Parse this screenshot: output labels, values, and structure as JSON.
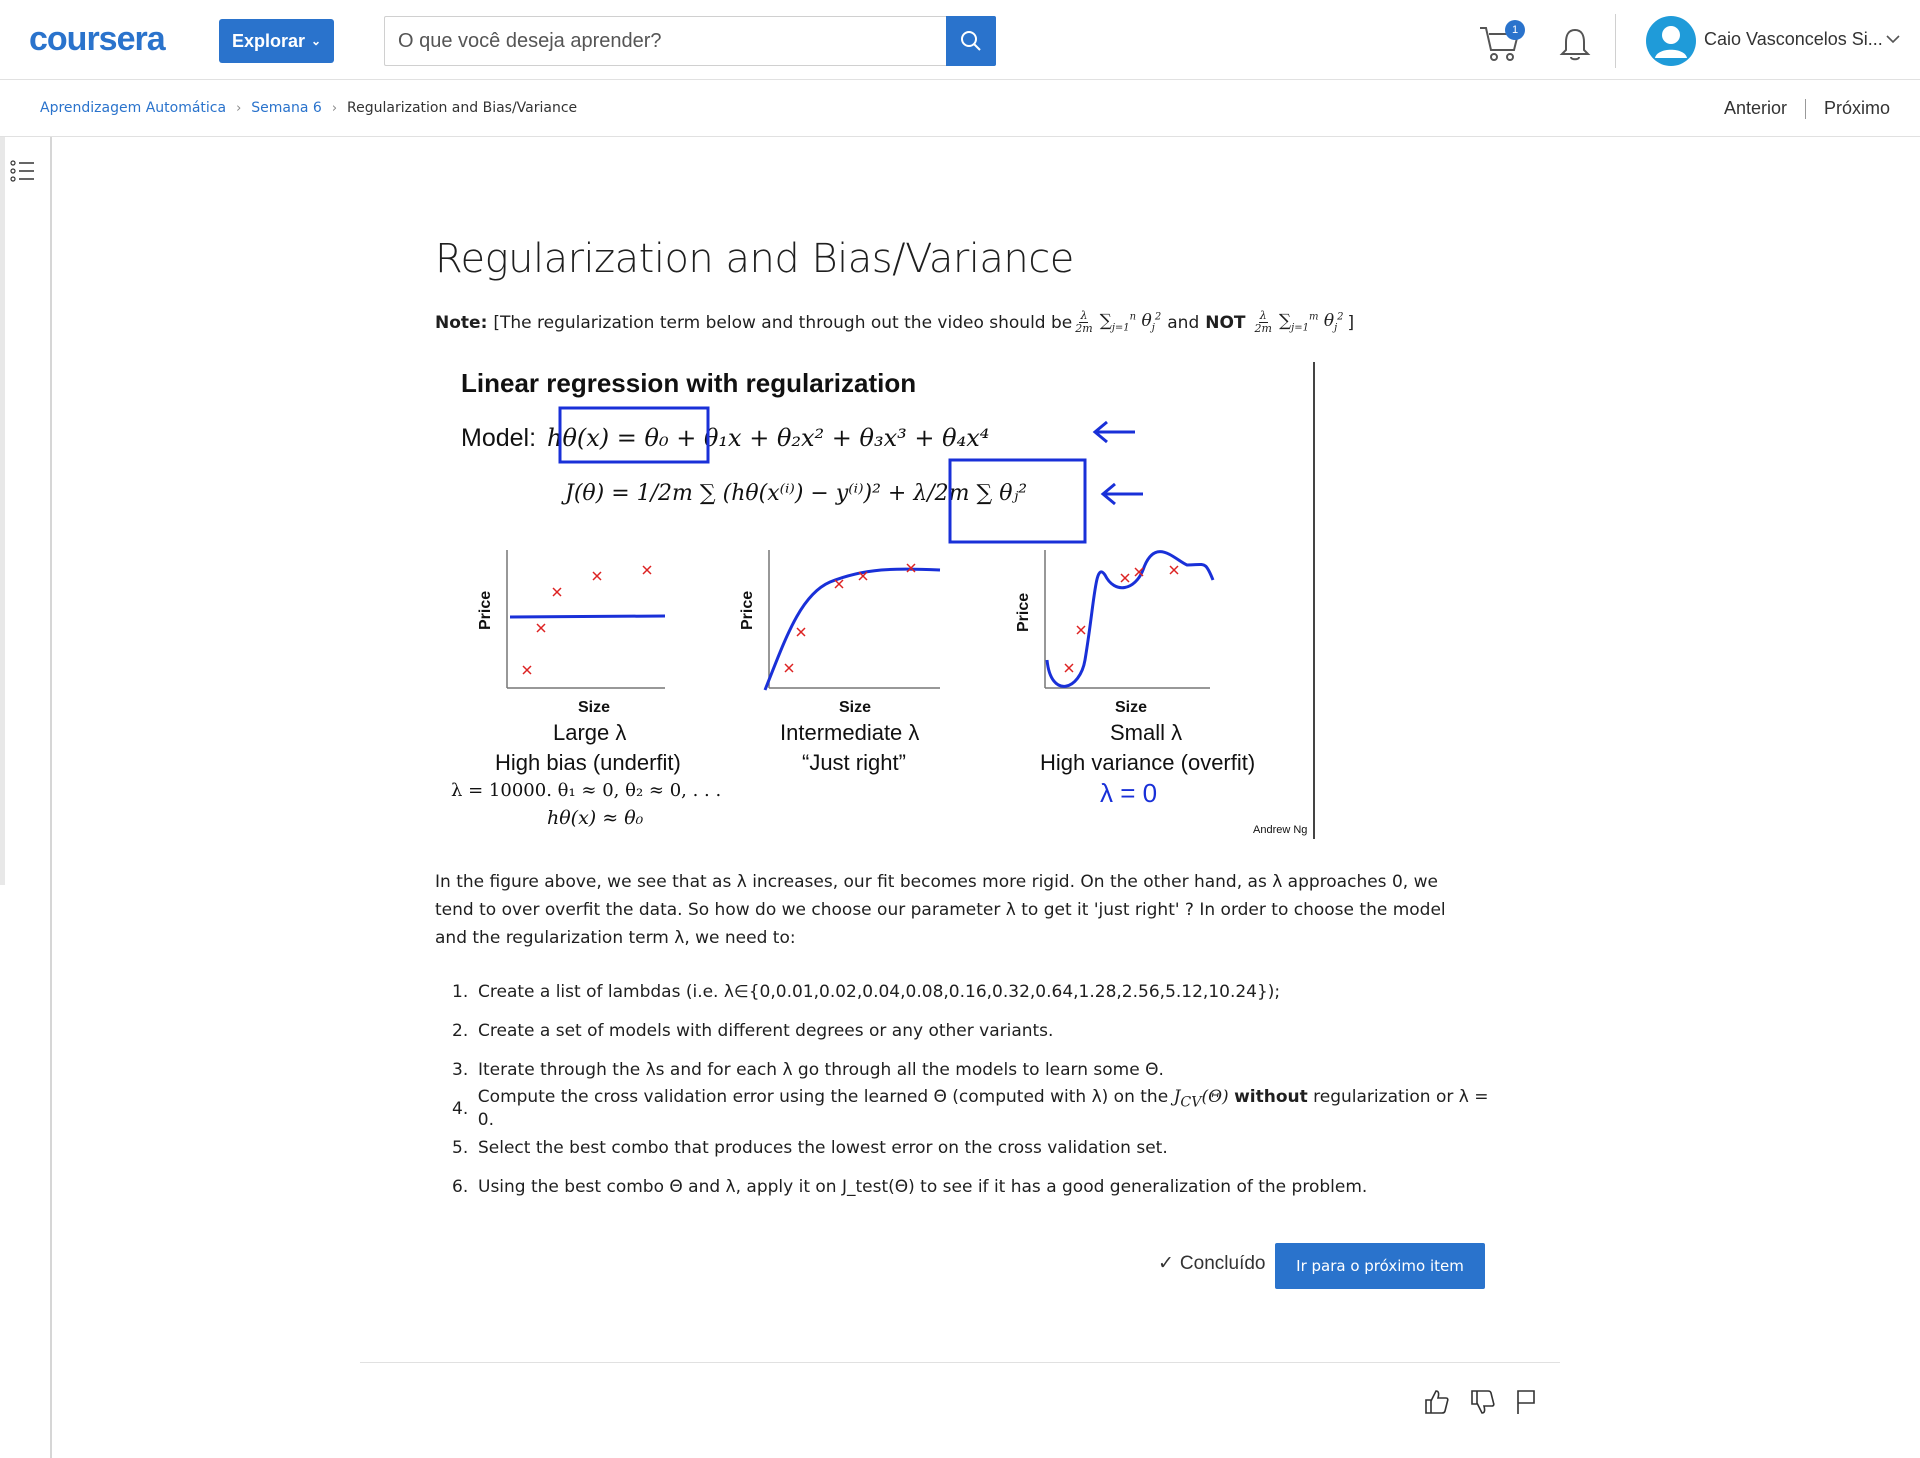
{
  "header": {
    "logo_text": "coursera",
    "explore_label": "Explorar",
    "search_placeholder": "O que você deseja aprender?",
    "cart_count": "1",
    "username": "Caio Vasconcelos Si...",
    "brand_color": "#2a73cc"
  },
  "breadcrumb": {
    "items": [
      "Aprendizagem Automática",
      "Semana 6",
      "Regularization and Bias/Variance"
    ],
    "prev_label": "Anterior",
    "next_label": "Próximo"
  },
  "content": {
    "title": "Regularization and Bias/Variance",
    "note_label": "Note:",
    "note_text": "[The regularization term below and through out the video should be",
    "note_and": "and",
    "note_not": "NOT",
    "note_close": "]",
    "figure": {
      "heading": "Linear regression with regularization",
      "model_label": "Model:",
      "axis_x": "Size",
      "axis_y": "Price",
      "caption_left_1": "Large λ",
      "caption_left_2": "High bias (underfit)",
      "caption_left_3": "λ = 10000. θ₁ ≈ 0, θ₂ ≈ 0, . . .",
      "caption_left_4": "hθ(x) ≈ θ₀",
      "caption_mid_1": "Intermediate λ",
      "caption_mid_2": "“Just right”",
      "caption_right_1": "Small λ",
      "caption_right_2": "High variance (overfit)",
      "caption_right_3": "λ = 0",
      "credit": "Andrew Ng"
    },
    "paragraph": "In the figure above, we see that as λ increases, our fit becomes more rigid. On the other hand, as λ approaches 0, we tend to over overfit the data. So how do we choose our parameter λ to get it 'just right' ? In order to choose the model and the regularization term λ, we need to:",
    "steps": [
      "Create a list of lambdas (i.e. λ∈{0,0.01,0.02,0.04,0.08,0.16,0.32,0.64,1.28,2.56,5.12,10.24});",
      "Create a set of models with different degrees or any other variants.",
      "Iterate through the λs and for each λ go through all the models to learn some Θ.",
      "Compute the cross validation error using the learned Θ (computed with λ) on the J_CV(Θ) without regularization or λ = 0.",
      "Select the best combo that produces the lowest error on the cross validation set.",
      "Using the best combo Θ and λ, apply it on J_test(Θ) to see if it has a good generalization of the problem."
    ],
    "step_numbers": [
      "1.",
      "2.",
      "3.",
      "4.",
      "5.",
      "6."
    ],
    "step4_before": "Compute the cross validation error using the learned Θ (computed with λ) on the ",
    "step4_bold": "without",
    "step4_after": " regularization or λ = 0.",
    "done_label": "Concluído",
    "next_item_label": "Ir para o próximo item"
  }
}
